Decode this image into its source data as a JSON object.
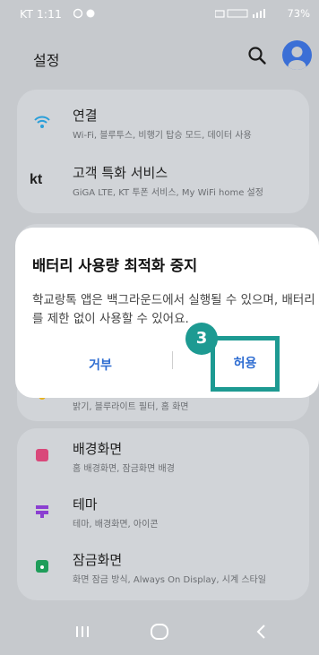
{
  "status_bar": {
    "time": "KT 1:11",
    "right": "73%"
  },
  "header": {
    "title": "설정",
    "search_icon": "search-icon",
    "account_icon": "account-icon"
  },
  "settings": [
    {
      "icon": "wifi-icon",
      "title": "연결",
      "subtitle": "Wi-Fi, 블루투스, 비행기 탑승 모드, 데이터 사용"
    },
    {
      "icon": "kt-logo-icon",
      "icon_text": "kt",
      "title": "고객 특화 서비스",
      "subtitle": "GiGA LTE, KT 투폰 서비스, My WiFi home 설정"
    },
    {
      "icon": "display-icon",
      "title": "",
      "subtitle": "밝기, 블루라이트 필터, 홈 화면"
    },
    {
      "icon": "wallpaper-icon",
      "title": "배경화면",
      "subtitle": "홈 배경화면, 잠금화면 배경"
    },
    {
      "icon": "theme-icon",
      "title": "테마",
      "subtitle": "테마, 배경화면, 아이콘"
    },
    {
      "icon": "lock-icon",
      "title": "잠금화면",
      "subtitle": "화면 잠금 방식, Always On Display, 시계 스타일"
    }
  ],
  "dialog": {
    "title": "배터리 사용량 최적화 중지",
    "message": "학교랑톡 앱은 백그라운드에서 실행될 수 있으며, 배터리를 제한 없이 사용할 수 있어요.",
    "deny_label": "거부",
    "allow_label": "허용",
    "step_badge": "3"
  },
  "colors": {
    "accent": "#2d6cd1",
    "highlight": "#1d9a92"
  }
}
